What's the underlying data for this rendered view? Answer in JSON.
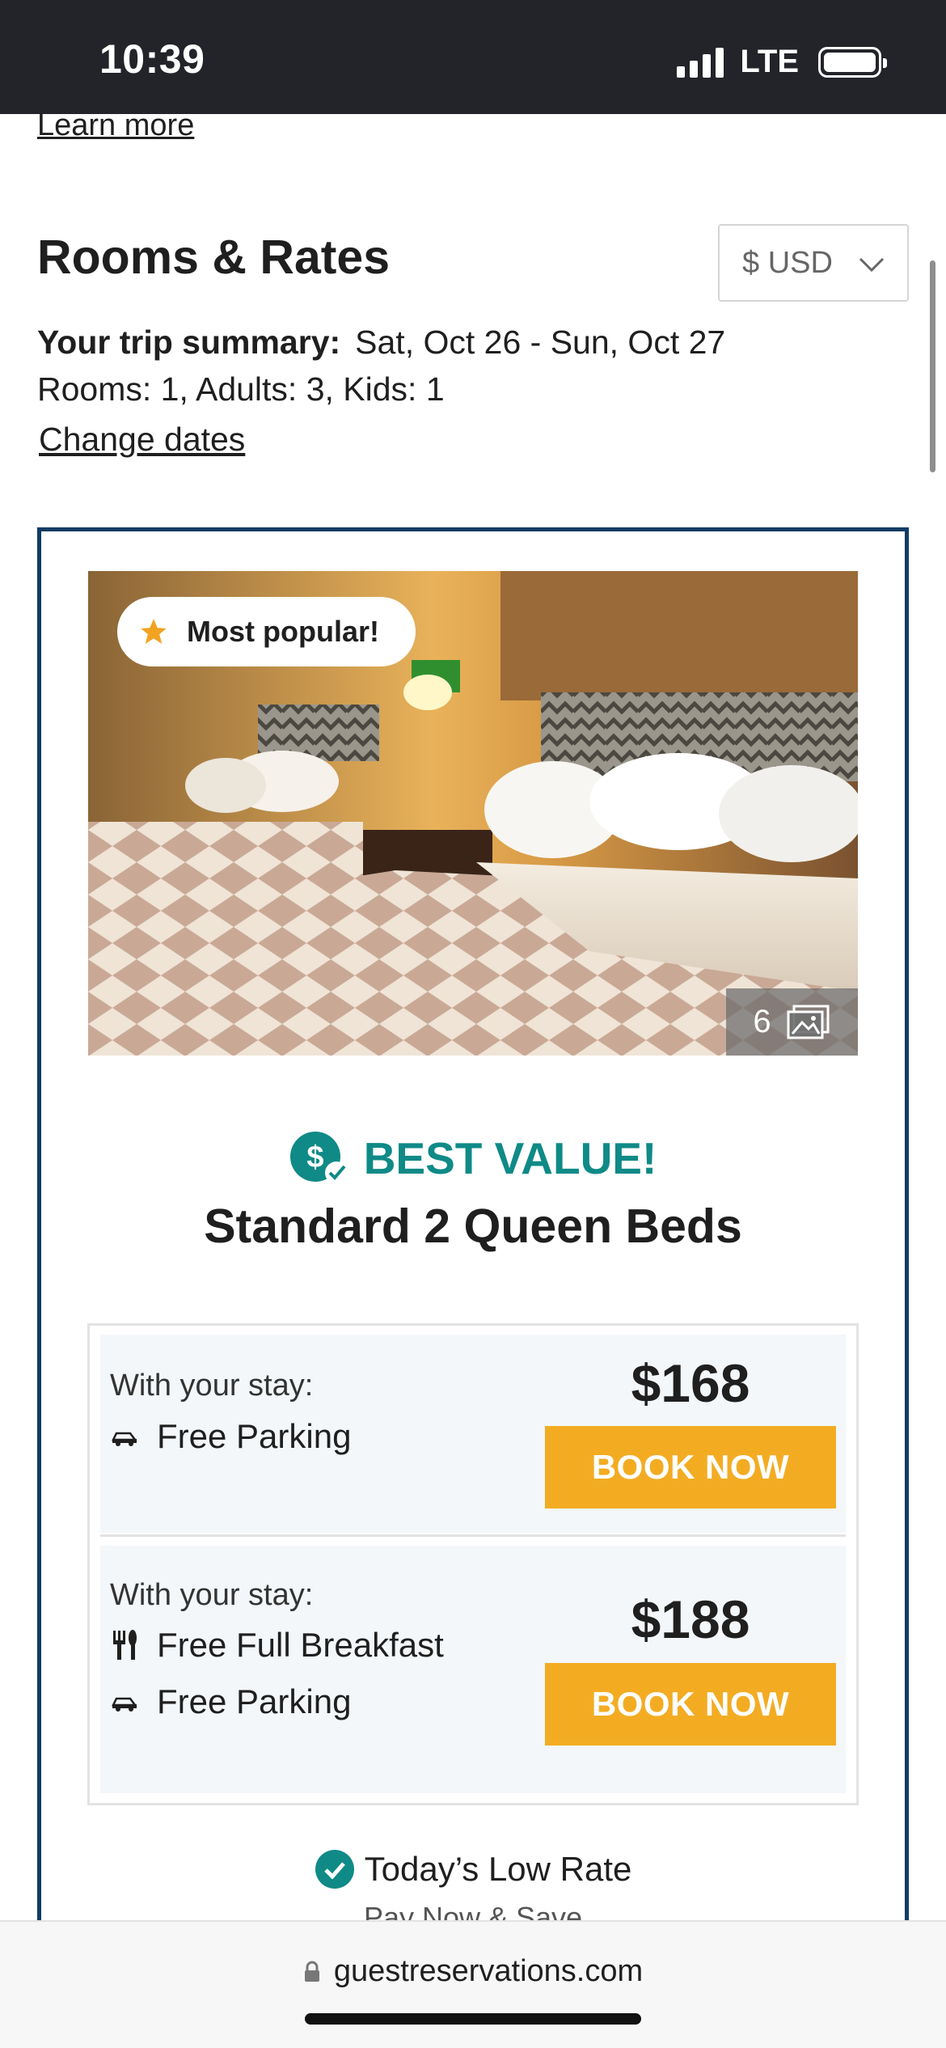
{
  "status_bar": {
    "time": "10:39",
    "network": "LTE"
  },
  "page": {
    "learn_more": "Learn more",
    "rooms_title": "Rooms & Rates",
    "currency": "$ USD",
    "trip_summary_label": "Your trip summary:",
    "trip_dates": "Sat, Oct 26 - Sun, Oct 27",
    "rooms_guests": "Rooms: 1, Adults: 3, Kids: 1",
    "change_dates": "Change dates"
  },
  "room": {
    "badge": "Most popular!",
    "photo_count": "6",
    "best_value": "BEST VALUE!",
    "name": "Standard 2 Queen Beds",
    "rates": [
      {
        "with_stay": "With your stay:",
        "amenities": [
          {
            "icon": "car-icon",
            "label": "Free Parking"
          }
        ],
        "price": "$168",
        "button": "BOOK NOW"
      },
      {
        "with_stay": "With your stay:",
        "amenities": [
          {
            "icon": "fork-knife-icon",
            "label": "Free Full Breakfast"
          },
          {
            "icon": "car-icon",
            "label": "Free Parking"
          }
        ],
        "price": "$188",
        "button": "BOOK NOW"
      }
    ],
    "low_rate": "Today’s Low Rate",
    "pay_now": "Pay Now & Save"
  },
  "browser": {
    "url": "guestreservations.com"
  },
  "colors": {
    "accent_teal": "#0f8a87",
    "book_button": "#f3ac22",
    "card_border": "#0f3c66",
    "status_bar": "#22242a"
  }
}
